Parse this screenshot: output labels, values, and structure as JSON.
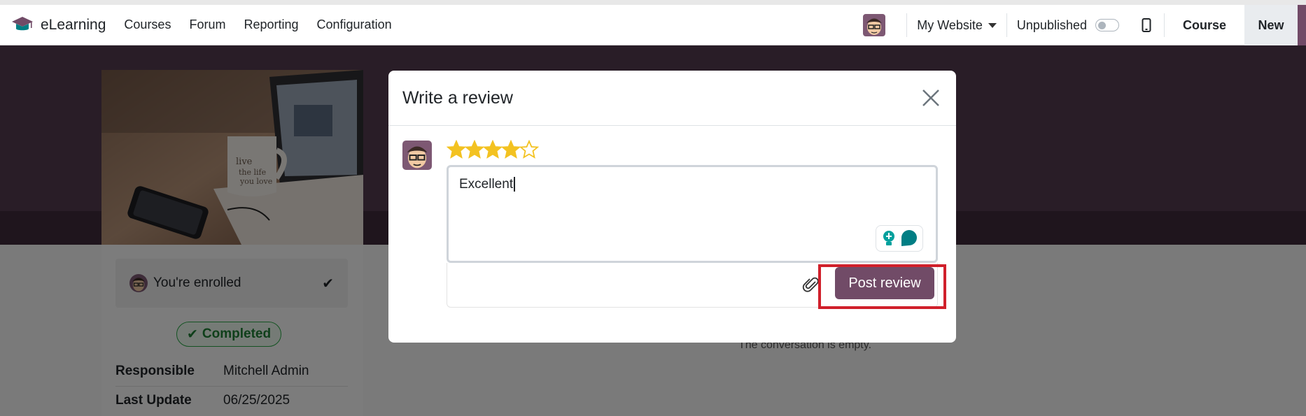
{
  "navbar": {
    "app_name": "eLearning",
    "menu": [
      "Courses",
      "Forum",
      "Reporting",
      "Configuration"
    ],
    "website_selector": "My Website",
    "publish_status": "Unpublished",
    "course_button": "Course",
    "new_button": "New"
  },
  "sidebar": {
    "enrolled_label": "You're enrolled",
    "completed_badge": "Completed",
    "responsible_label": "Responsible",
    "responsible_value": "Mitchell Admin",
    "last_update_label": "Last Update",
    "last_update_value": "06/25/2025"
  },
  "conversation": {
    "empty_text": "The conversation is empty."
  },
  "review_dialog": {
    "title": "Write a review",
    "rating": 4,
    "max_rating": 5,
    "review_text": "Excellent",
    "post_button": "Post review"
  },
  "icons": {
    "brand": "graduation-cap-icon",
    "close": "close-icon",
    "attach": "paperclip-icon",
    "mobile": "mobile-icon",
    "check": "check-icon",
    "star_filled": "star-filled-icon",
    "star_empty": "star-empty-icon"
  },
  "colors": {
    "primary": "#714b67",
    "star": "#f3c221",
    "success": "#28a745",
    "highlight": "#d0202b"
  }
}
